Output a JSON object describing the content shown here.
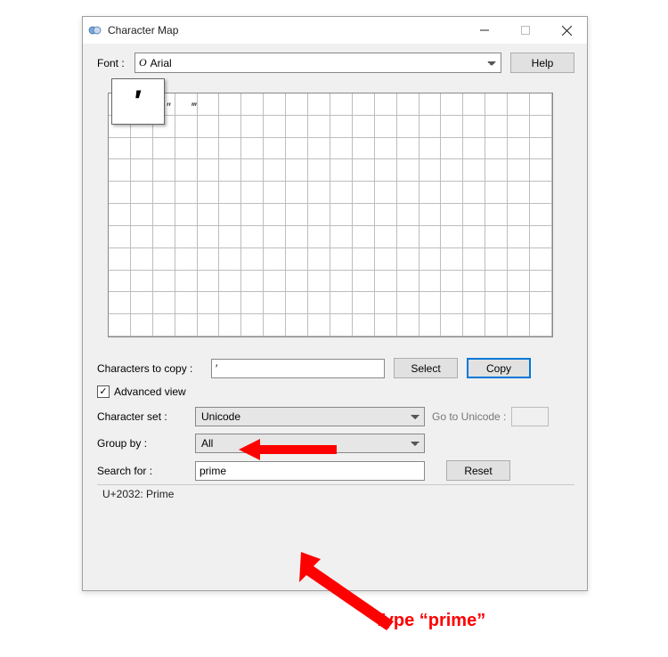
{
  "window": {
    "title": "Character Map"
  },
  "labels": {
    "font": "Font :",
    "help": "Help",
    "chars_to_copy": "Characters to copy :",
    "select": "Select",
    "copy": "Copy",
    "advanced_view": "Advanced view",
    "charset": "Character set :",
    "go_to": "Go to Unicode :",
    "group_by": "Group by :",
    "search_for": "Search for :",
    "reset": "Reset"
  },
  "font": {
    "prefix": "O",
    "selected": "Arial"
  },
  "preview_char": "′",
  "grid_chars": "″  ‴",
  "copy_value": "′",
  "advanced_checked": true,
  "charset_value": "Unicode",
  "group_by_value": "All",
  "search_value": "prime",
  "status": "U+2032: Prime",
  "annotation": "Type “prime”"
}
